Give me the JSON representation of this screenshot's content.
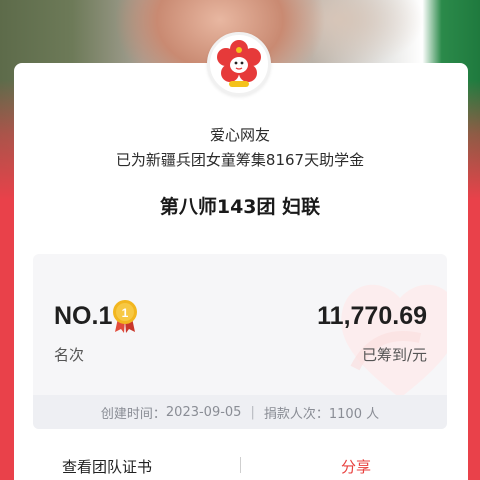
{
  "donor": {
    "name": "爱心网友",
    "description": "已为新疆兵团女童筹集8167天助学金"
  },
  "team": {
    "name": "第八师143团 妇联"
  },
  "stats": {
    "rank_value": "NO.1",
    "rank_label": "名次",
    "medal_number": "1",
    "amount_value": "11,770.69",
    "amount_label": "已筹到/元",
    "created_label": "创建时间：",
    "created_date": "2023-09-05",
    "separator": "|",
    "donors_label": "捐款人次：",
    "donors_count": "1100 人"
  },
  "actions": {
    "certificate_label": "查看团队证书",
    "share_label": "分享"
  },
  "colors": {
    "primary_red": "#e9414a",
    "share_red": "#e8413f",
    "medal_gold": "#f2b61f"
  },
  "icons": {
    "avatar": "red-flower-mascot-icon",
    "medal": "gold-medal-icon",
    "decoration": "heart-decoration-icon"
  }
}
